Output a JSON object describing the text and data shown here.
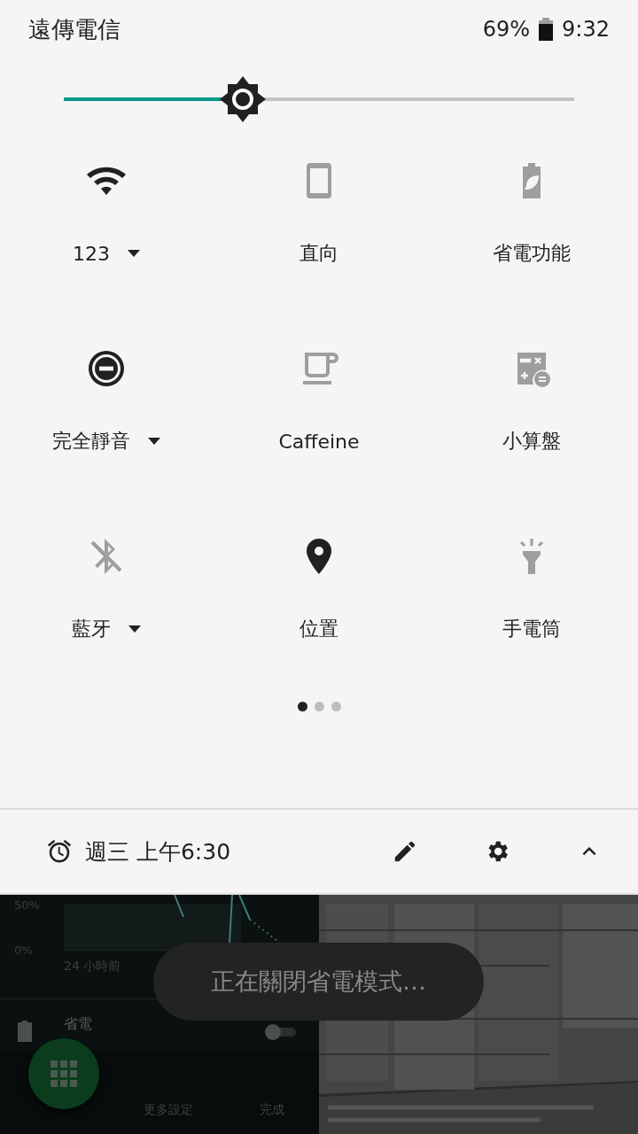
{
  "status_bar": {
    "carrier": "遠傳電信",
    "battery": "69%",
    "time": "9:32"
  },
  "brightness": {
    "level": 0.35
  },
  "tiles": [
    {
      "label": "123",
      "on": true,
      "dropdown": true
    },
    {
      "label": "直向",
      "on": false,
      "dropdown": false
    },
    {
      "label": "省電功能",
      "on": false,
      "dropdown": false
    },
    {
      "label": "完全靜音",
      "on": true,
      "dropdown": true
    },
    {
      "label": "Caffeine",
      "on": false,
      "dropdown": false
    },
    {
      "label": "小算盤",
      "on": false,
      "dropdown": false
    },
    {
      "label": "藍牙",
      "on": false,
      "dropdown": true
    },
    {
      "label": "位置",
      "on": true,
      "dropdown": false
    },
    {
      "label": "手電筒",
      "on": false,
      "dropdown": false
    }
  ],
  "pages": [
    {
      "selected": true
    },
    {
      "selected": false
    },
    {
      "selected": false
    }
  ],
  "footer": {
    "alarm": "週三 上午6:30"
  },
  "background_app": {
    "axis_labels": [
      "50%",
      "0%"
    ],
    "time_label": "24 小時前",
    "setting": {
      "label": "省電",
      "on": false
    },
    "buttons": [
      "更多設定",
      "完成"
    ]
  },
  "toast": "正在關閉省電模式…"
}
